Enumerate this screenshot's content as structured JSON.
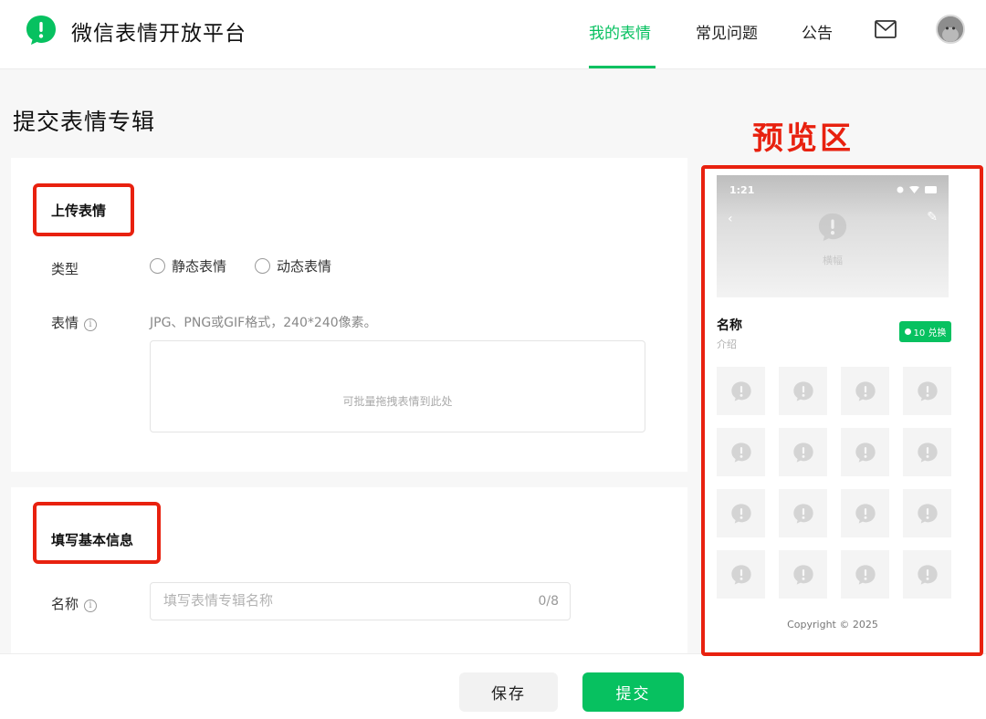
{
  "header": {
    "brand": "微信表情开放平台",
    "nav": [
      {
        "label": "我的表情",
        "active": true
      },
      {
        "label": "常见问题",
        "active": false
      },
      {
        "label": "公告",
        "active": false
      }
    ],
    "icons": [
      "wechat-logo-icon",
      "mail-icon",
      "avatar"
    ]
  },
  "page": {
    "title": "提交表情专辑"
  },
  "upload": {
    "section_title": "上传表情",
    "type_label": "类型",
    "type_options": [
      "静态表情",
      "动态表情"
    ],
    "sticker_label": "表情",
    "format_hint": "JPG、PNG或GIF格式，240*240像素。",
    "drop_text": "可批量拖拽表情到此处"
  },
  "basic_info": {
    "section_title": "填写基本信息",
    "name_label": "名称",
    "name_placeholder": "填写表情专辑名称",
    "name_counter": "0/8"
  },
  "actions": {
    "save": "保存",
    "submit": "提交"
  },
  "preview": {
    "annotation": "预览区",
    "status_time": "1:21",
    "caption": "横幅",
    "name": "名称",
    "description": "介绍",
    "badge": "10 兑换",
    "copyright": "Copyright © 2025",
    "grid_cells": 16
  },
  "colors": {
    "accent": "#07c160",
    "annotation": "#e8210f"
  }
}
